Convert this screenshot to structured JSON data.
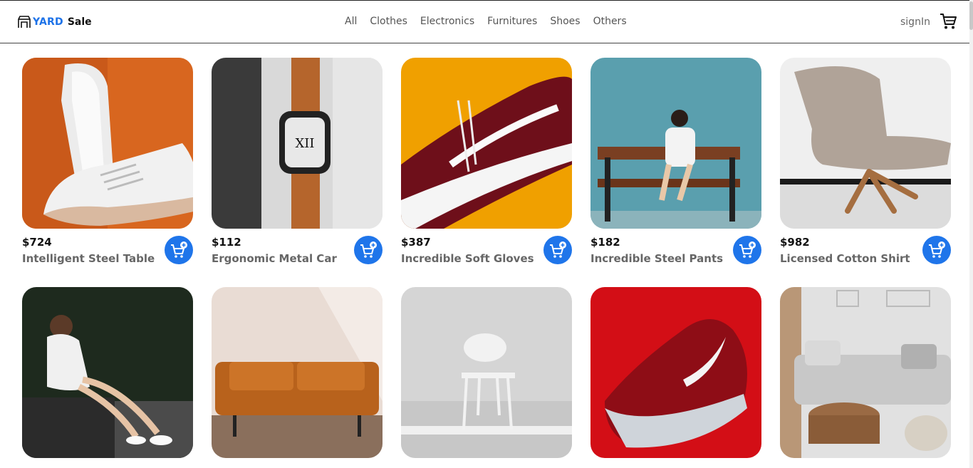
{
  "brand": {
    "part1": "YARD",
    "part2": "Sale"
  },
  "nav": [
    "All",
    "Clothes",
    "Electronics",
    "Furnitures",
    "Shoes",
    "Others"
  ],
  "header": {
    "signin": "signIn",
    "cart_icon": "shopping-cart-icon"
  },
  "colors": {
    "accent": "#1f75ea",
    "price": "#111111",
    "name": "#666666"
  },
  "products": [
    {
      "price": "$724",
      "name": "Intelligent Steel Table",
      "image": "white-sneaker-orange-background"
    },
    {
      "price": "$112",
      "name": "Ergonomic Metal Car",
      "image": "smartwatch-leather-strap"
    },
    {
      "price": "$387",
      "name": "Incredible Soft Gloves",
      "image": "maroon-sneaker-yellow-background"
    },
    {
      "price": "$182",
      "name": "Incredible Steel Pants",
      "image": "woman-on-bench-teal-wall"
    },
    {
      "price": "$982",
      "name": "Licensed Cotton Shirt",
      "image": "grey-lounge-chair"
    },
    {
      "price": "",
      "name": "",
      "image": "woman-sitting-on-rock"
    },
    {
      "price": "",
      "name": "",
      "image": "orange-leather-sofa"
    },
    {
      "price": "",
      "name": "",
      "image": "white-chair-grey-room"
    },
    {
      "price": "",
      "name": "",
      "image": "red-nike-sneaker"
    },
    {
      "price": "",
      "name": "",
      "image": "living-room-grey-sofa"
    }
  ]
}
